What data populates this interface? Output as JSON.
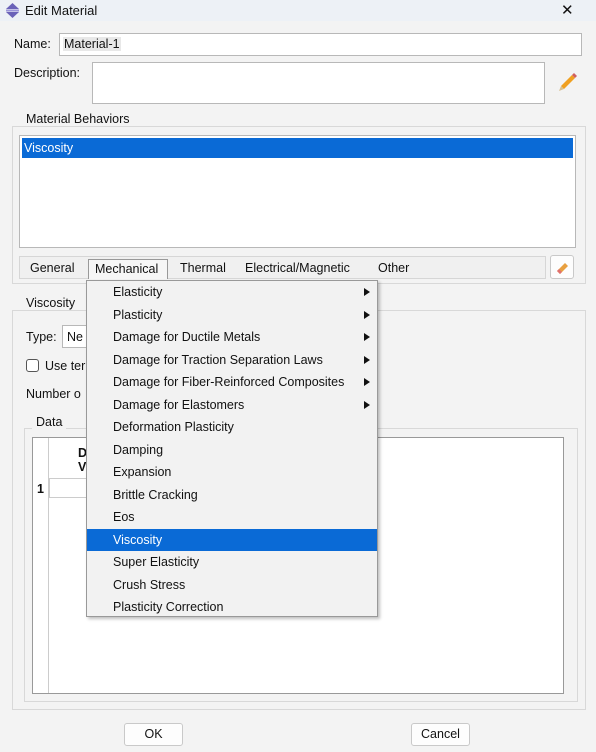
{
  "window": {
    "title": "Edit Material",
    "close": "✕"
  },
  "name": {
    "label": "Name:",
    "value": "Material-1"
  },
  "description": {
    "label": "Description:",
    "value": ""
  },
  "behaviors": {
    "group_label": "Material Behaviors",
    "items": [
      "Viscosity"
    ],
    "selected": "Viscosity"
  },
  "tabs": [
    "General",
    "Mechanical",
    "Thermal",
    "Electrical/Magnetic",
    "Other"
  ],
  "active_tab": "Mechanical",
  "viscosity_panel": {
    "group_label": "Viscosity",
    "type_label": "Type:",
    "type_value": "Ne",
    "use_temp_label": "Use ter",
    "use_temp_checked": false,
    "number_label": "Number o",
    "data_label": "Data",
    "col_header_1": "D",
    "col_header_2": "V",
    "row_1": "1"
  },
  "menu": {
    "items": [
      {
        "label": "Elasticity",
        "submenu": true
      },
      {
        "label": "Plasticity",
        "submenu": true
      },
      {
        "label": "Damage for Ductile Metals",
        "submenu": true
      },
      {
        "label": "Damage for Traction Separation Laws",
        "submenu": true
      },
      {
        "label": "Damage for Fiber-Reinforced Composites",
        "submenu": true
      },
      {
        "label": "Damage for Elastomers",
        "submenu": true
      },
      {
        "label": "Deformation Plasticity",
        "submenu": false
      },
      {
        "label": "Damping",
        "submenu": false
      },
      {
        "label": "Expansion",
        "submenu": false
      },
      {
        "label": "Brittle Cracking",
        "submenu": false
      },
      {
        "label": "Eos",
        "submenu": false
      },
      {
        "label": "Viscosity",
        "submenu": false,
        "highlighted": true
      },
      {
        "label": "Super Elasticity",
        "submenu": false
      },
      {
        "label": "Crush Stress",
        "submenu": false
      },
      {
        "label": "Plasticity Correction",
        "submenu": false
      }
    ]
  },
  "buttons": {
    "ok": "OK",
    "cancel": "Cancel"
  },
  "colors": {
    "selection": "#0a6ad6",
    "titlebar": "#edf1f6"
  },
  "icons": {
    "app": "abaqus-material-icon",
    "description_edit": "pencil-icon",
    "behavior_delete": "eraser-icon"
  }
}
